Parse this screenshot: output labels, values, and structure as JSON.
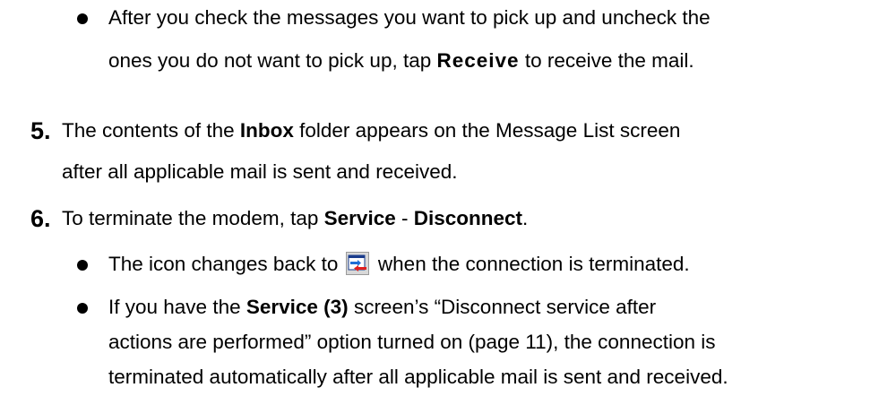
{
  "bullet1": {
    "line1": "After you check the messages you want to pick up and uncheck the",
    "line2_pre": "ones you do not want to pick up, tap ",
    "line2_bold": "Receive",
    "line2_post": " to receive the mail."
  },
  "step5": {
    "number": "5.",
    "line1_pre": "The contents of the ",
    "line1_bold": "Inbox",
    "line1_post": " folder appears on the Message List screen",
    "line2": "after all applicable mail is sent and received."
  },
  "step6": {
    "number": "6.",
    "line1_pre": "To terminate the modem, tap ",
    "line1_bold1": "Service",
    "line1_sep": " - ",
    "line1_bold2": "Disconnect",
    "line1_post": "."
  },
  "bullet2": {
    "pre": "The icon changes back to ",
    "icon": "disconnected-service-icon",
    "post": " when the connection is terminated."
  },
  "bullet3": {
    "line1_pre": "If you have the ",
    "line1_bold": "Service (3)",
    "line1_post": " screen’s “Disconnect service after",
    "line2": "actions are performed” option turned on (page 11), the connection is",
    "line3": "terminated automatically after all applicable mail is sent and received."
  }
}
